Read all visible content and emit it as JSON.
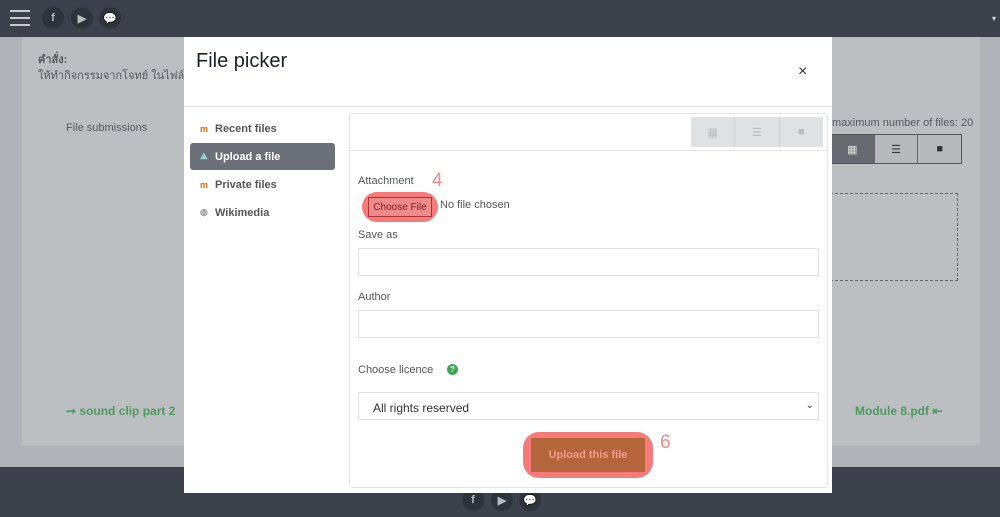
{
  "topbar": {
    "icons": [
      "menu-icon",
      "facebook-icon",
      "youtube-icon",
      "chat-icon"
    ],
    "facebook": "f",
    "youtube": "▶",
    "chat": "💬",
    "caret": "▾"
  },
  "background": {
    "instructions_label": "คำสั่ง:",
    "instructions_text": "ให้ทำกิจกรรมจากโจทย์ ในไฟล์ และ",
    "file_submissions": "File submissions",
    "max_files": "maximum number of files: 20",
    "prev_link": "➞ sound clip part 2",
    "next_link": "Module 8.pdf ⇤"
  },
  "modal": {
    "title": "File picker",
    "close": "×",
    "sidebar": [
      {
        "label": "Recent files",
        "icon": "moodle-icon"
      },
      {
        "label": "Upload a file",
        "icon": "upload-icon",
        "active": true
      },
      {
        "label": "Private files",
        "icon": "moodle-icon"
      },
      {
        "label": "Wikimedia",
        "icon": "wikipedia-icon"
      }
    ],
    "view_buttons": [
      "grid-view-icon",
      "list-view-icon",
      "folder-view-icon"
    ],
    "form": {
      "attachment_label": "Attachment",
      "choose_file": "Choose File",
      "no_file": "No file chosen",
      "save_as_label": "Save as",
      "save_as_value": "",
      "author_label": "Author",
      "author_value": "",
      "licence_label": "Choose licence",
      "licence_value": "All rights reserved",
      "upload_button": "Upload this file"
    },
    "annotations": {
      "step_choose": "4",
      "step_upload": "6"
    }
  },
  "colors": {
    "highlight": "#f77a7a",
    "upload_button": "#b3663c",
    "topbar": "#3c414c",
    "link_green": "#4d9a5e"
  }
}
